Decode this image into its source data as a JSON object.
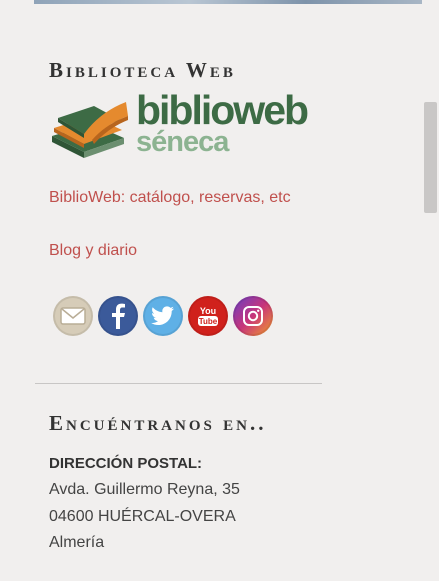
{
  "widgets": {
    "biblioteca": {
      "title": "Biblioteca Web",
      "logo": {
        "main": "biblioweb",
        "sub": "séneca"
      },
      "links": [
        "BiblioWeb: catálogo, reservas, etc",
        "Blog y diario"
      ]
    },
    "encuentranos": {
      "title": "Encuéntranos en..",
      "address_label": "DIRECCIÓN POSTAL:",
      "address_lines": [
        "Avda. Guillermo Reyna, 35",
        "04600 HUÉRCAL-OVERA",
        "Almería"
      ]
    }
  },
  "social": [
    {
      "icon": "envelope-icon"
    },
    {
      "icon": "facebook-icon"
    },
    {
      "icon": "twitter-icon"
    },
    {
      "icon": "youtube-icon",
      "text": "You Tube"
    },
    {
      "icon": "instagram-icon"
    }
  ],
  "colors": {
    "background": "#f1efee",
    "link": "#c0504d",
    "logo_green": "#3d6b45",
    "logo_light_green": "#8cb391"
  }
}
